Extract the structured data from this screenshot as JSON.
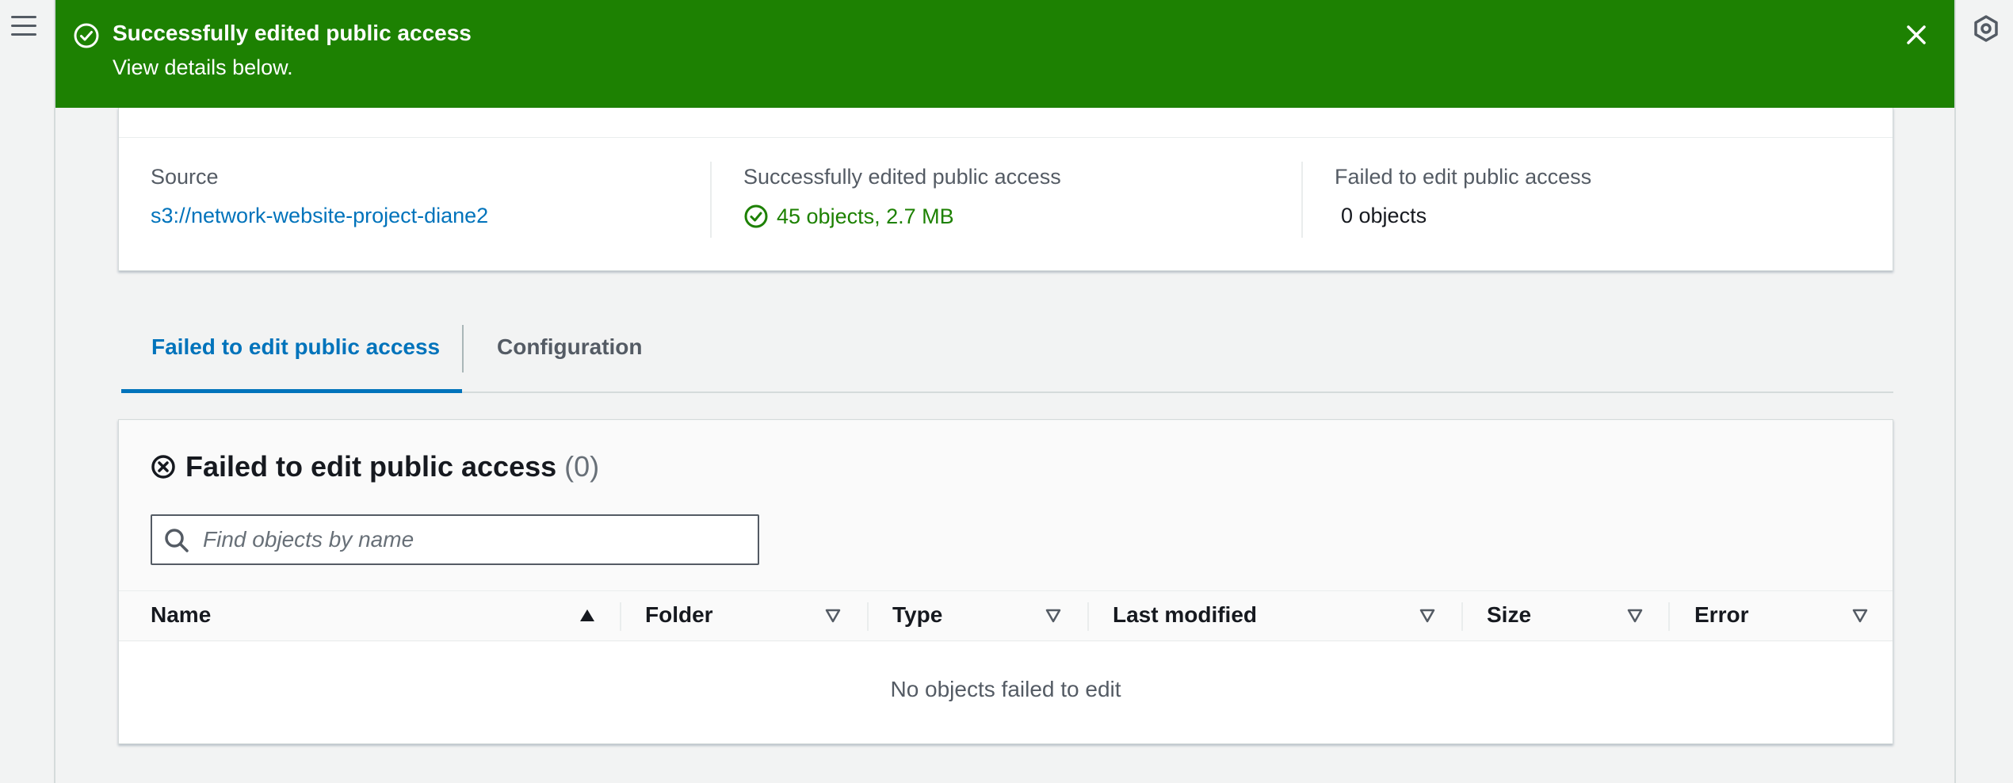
{
  "flash": {
    "title": "Successfully edited public access",
    "subtitle": "View details below.",
    "color": "#1d8102"
  },
  "summary": {
    "source_label": "Source",
    "source_value": "s3://network-website-project-diane2",
    "success_label": "Successfully edited public access",
    "success_value": "45 objects, 2.7 MB",
    "failed_label": "Failed to edit public access",
    "failed_value": "0 objects"
  },
  "tabs": [
    {
      "label": "Failed to edit public access",
      "active": true
    },
    {
      "label": "Configuration",
      "active": false
    }
  ],
  "panel": {
    "title": "Failed to edit public access",
    "count": "(0)",
    "search_placeholder": "Find objects by name",
    "columns": [
      {
        "label": "Name",
        "sort": "ascending"
      },
      {
        "label": "Folder",
        "sort": "none"
      },
      {
        "label": "Type",
        "sort": "none"
      },
      {
        "label": "Last modified",
        "sort": "none"
      },
      {
        "label": "Size",
        "sort": "none"
      },
      {
        "label": "Error",
        "sort": "none"
      }
    ],
    "empty_message": "No objects failed to edit"
  },
  "colors": {
    "link": "#0073bb",
    "success": "#1d8102",
    "text": "#16191f",
    "muted": "#545b64"
  }
}
